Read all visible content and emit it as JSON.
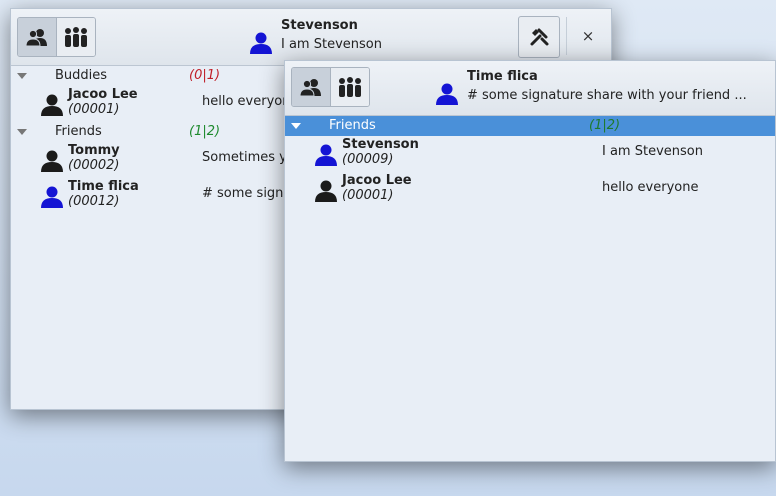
{
  "window_back": {
    "toolbar": {
      "contacts_icon": "contacts-icon",
      "groups_icon": "groups-icon",
      "tools_icon": "wrench-icon",
      "close_label": "×"
    },
    "profile": {
      "name": "Stevenson",
      "signature": "I am Stevenson",
      "avatar_color": "#1414d4"
    },
    "groups": [
      {
        "name": "Buddies",
        "count": "(0|1)",
        "count_color": "red",
        "members": [
          {
            "name": "Jacoo Lee",
            "id": "(00001)",
            "signature": "hello everyone",
            "avatar_color": "#1b1b1b"
          }
        ]
      },
      {
        "name": "Friends",
        "count": "(1|2)",
        "count_color": "green",
        "members": [
          {
            "name": "Tommy",
            "id": "(00002)",
            "signature": "Sometimes y",
            "avatar_color": "#1b1b1b"
          },
          {
            "name": "Time flica",
            "id": "(00012)",
            "signature": "# some signa",
            "avatar_color": "#1414d4"
          }
        ]
      }
    ]
  },
  "window_front": {
    "toolbar": {
      "contacts_icon": "contacts-icon",
      "groups_icon": "groups-icon"
    },
    "profile": {
      "name": "Time flica",
      "signature": "# some signature share with your friend ...",
      "avatar_color": "#1414d4"
    },
    "groups": [
      {
        "name": "Friends",
        "count": "(1|2)",
        "selected": true,
        "members": [
          {
            "name": "Stevenson",
            "id": "(00009)",
            "signature": "I am Stevenson",
            "avatar_color": "#1414d4"
          },
          {
            "name": "Jacoo Lee",
            "id": "(00001)",
            "signature": "hello everyone",
            "avatar_color": "#1b1b1b"
          }
        ]
      }
    ]
  },
  "colors": {
    "selection": "#4a90d9",
    "offline_count": "#c0202a",
    "online_count": "#1e8a2e",
    "online_avatar": "#1414d4",
    "offline_avatar": "#1b1b1b"
  }
}
